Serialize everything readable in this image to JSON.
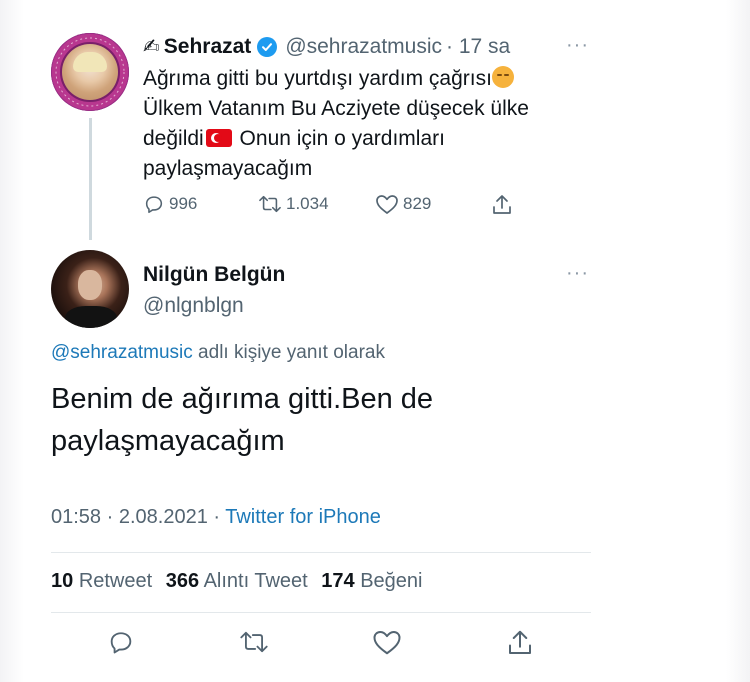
{
  "parent_tweet": {
    "name_emoji": "✍",
    "name": "Sehrazat",
    "handle": "@sehrazatmusic",
    "time": "· 17 sa",
    "more": "···",
    "line1": "Ağrıma gitti bu yurtdışı yardım çağrısı",
    "line2": "Ülkem Vatanım Bu Acziyete düşecek ülke",
    "line3a": "değildi",
    "line3b": " Onun için o yardımları",
    "line4": "paylaşmayacağım",
    "replies": "996",
    "retweets": "1.034",
    "likes": "829"
  },
  "reply_tweet": {
    "name": "Nilgün Belgün",
    "handle": "@nlgnblgn",
    "more": "···",
    "replying_to_handle": "@sehrazatmusic",
    "replying_to_suffix": " adlı kişiye yanıt olarak",
    "text_line1": "Benim de ağırıma gitti.Ben de",
    "text_line2": "paylaşmayacağım",
    "time": "01:58",
    "sep1": " · ",
    "date": "2.08.2021",
    "sep2": " · ",
    "source": "Twitter for iPhone",
    "retweet_count": "10",
    "retweet_label": "Retweet",
    "quote_count": "366",
    "quote_label": "Alıntı Tweet",
    "like_count": "174",
    "like_label": "Beğeni"
  },
  "colors": {
    "link": "#1d79b8",
    "muted": "#536471",
    "verified": "#1d9bf0",
    "text": "#0f1419"
  },
  "icons": [
    "writing-hand-icon",
    "verified-badge-icon",
    "more-icon",
    "reply-icon",
    "retweet-icon",
    "like-icon",
    "share-icon",
    "turkish-flag-icon",
    "face-emoji-icon"
  ]
}
